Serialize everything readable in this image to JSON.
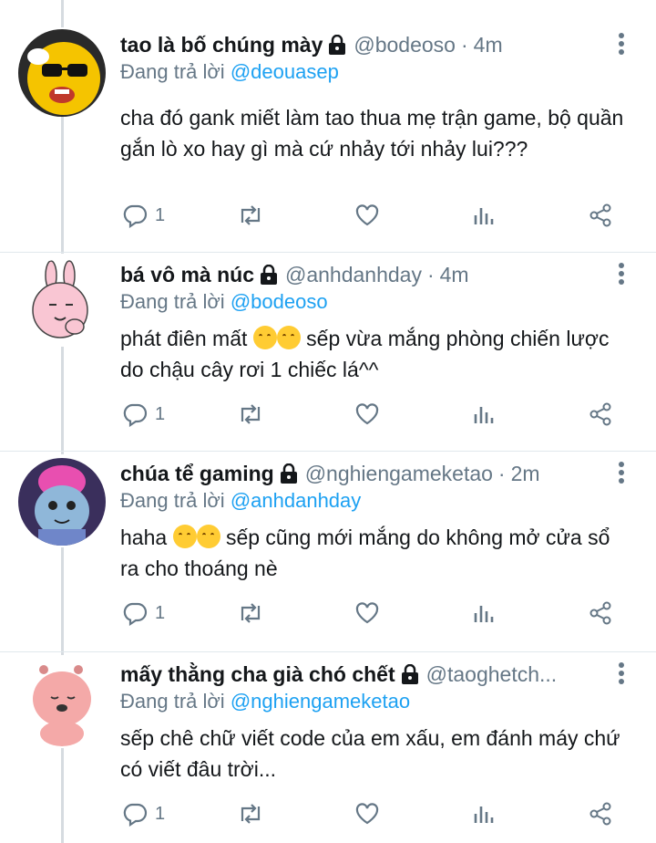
{
  "colors": {
    "mention": "#1da1f2",
    "muted": "#657786",
    "text": "#14171a",
    "divider": "#e1e8ed"
  },
  "icons": [
    "lock-icon",
    "more-vertical-icon",
    "reply-icon",
    "retweet-icon",
    "like-icon",
    "analytics-icon",
    "share-icon"
  ],
  "replying_prefix": "Đang trả lời",
  "tweets": [
    {
      "display_name": "tao là bố chúng mày",
      "handle": "@bodeoso",
      "time": "4m",
      "reply_to": "@deouasep",
      "text": "cha đó gank miết làm tao thua mẹ trận game, bộ quần gắn lò xo hay gì mà cứ nhảy tới nhảy lui???",
      "reply_count": "1"
    },
    {
      "display_name": "bá vô mà núc",
      "handle": "@anhdanhday",
      "time": "4m",
      "reply_to": "@bodeoso",
      "text_before": "phát điên mất",
      "text_after": "sếp vừa mắng phòng chiến lược do chậu cây rơi 1 chiếc lá^^",
      "reply_count": "1"
    },
    {
      "display_name": "chúa tể gaming",
      "handle": "@nghiengameketao",
      "time": "2m",
      "reply_to": "@anhdanhday",
      "text_before": "haha",
      "text_after": "sếp cũng mới mắng do không mở cửa sổ ra cho thoáng nè",
      "reply_count": "1"
    },
    {
      "display_name": "mấy thằng cha già chó chết",
      "handle": "@taoghetch...",
      "time": "",
      "reply_to": "@nghiengameketao",
      "text": "sếp chê chữ viết code của em xấu, em đánh máy chứ có viết đâu trời...",
      "reply_count": "1"
    }
  ]
}
